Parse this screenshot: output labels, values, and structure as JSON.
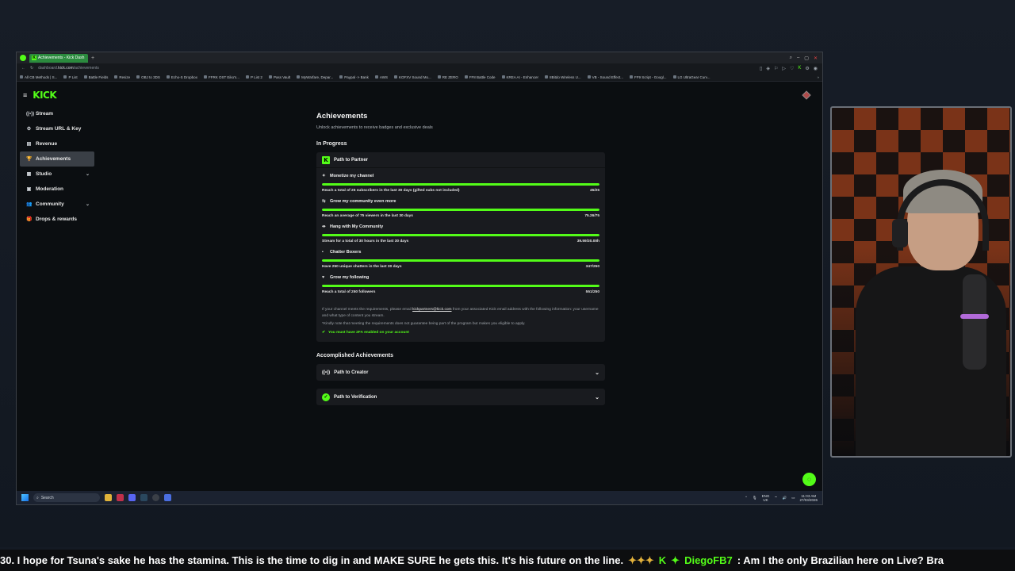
{
  "browser": {
    "tab_title": "Achievements - Kick Dash",
    "url_prefix": "dashboard.",
    "url_domain": "kick.com",
    "url_path": "/achievements",
    "bookmarks": [
      "All CB Methods | S...",
      "P List",
      "Battle Fields",
      "Resize",
      "OBJ to 3DS",
      "Echo-S Dropbox",
      "FFRK OST Eiko's...",
      "P List 2",
      "Pass Vault",
      "MyWarfare, Depar...",
      "Paypal -> Bank",
      "AWS",
      "KOFXV Sound Mo...",
      "RE ZERO",
      "FF8 Battle Code",
      "KREA AI - Enhancer",
      "8Bitdo Wireless U...",
      "VB - Sound Effect...",
      "FF9 Script - Googl...",
      "LG UltraGear Curv..."
    ]
  },
  "sidebar": {
    "logo": "KICK",
    "items": [
      {
        "label": "Stream",
        "icon": "((•))"
      },
      {
        "label": "Stream URL & Key",
        "icon": "⚙"
      },
      {
        "label": "Revenue",
        "icon": "▤"
      },
      {
        "label": "Achievements",
        "icon": "🏆"
      },
      {
        "label": "Studio",
        "icon": "▦"
      },
      {
        "label": "Moderation",
        "icon": "▣"
      },
      {
        "label": "Community",
        "icon": "👥"
      },
      {
        "label": "Drops & rewards",
        "icon": "🎁"
      }
    ]
  },
  "main": {
    "title": "Achievements",
    "subtitle": "Unlock achievements to receive badges and exclusive deals",
    "in_progress_heading": "In Progress",
    "partner": {
      "badge": "K",
      "title": "Path to Partner",
      "goals": [
        {
          "title": "Monetize my channel",
          "icon": "✦",
          "desc": "Reach a total of 25 subscribers in the last 30 days (gifted subs not included)",
          "progress": "45/25",
          "fill": 1.0
        },
        {
          "title": "Grow my community even more",
          "icon": "⇆",
          "desc": "Reach an average of 75 viewers in the last 30 days",
          "progress": "75.26/75",
          "fill": 1.0
        },
        {
          "title": "Hang with My Community",
          "icon": "⇹",
          "desc": "Stream for a total of 30 hours in the last 30 days",
          "progress": "39.59/30.00h",
          "fill": 1.0
        },
        {
          "title": "Chatter Boxers",
          "icon": "▪",
          "desc": "Have 250 unique chatters in the last 30 days",
          "progress": "347/250",
          "fill": 1.0
        },
        {
          "title": "Grow my following",
          "icon": "♥",
          "desc": "Reach a total of 250 followers",
          "progress": "551/250",
          "fill": 1.0
        }
      ],
      "note1_before": "If your channel meets the requirements, please email ",
      "note1_email": "kickpartners@kick.com",
      "note1_after": " from your associated Kick email address with the following information: your username and what type of content you stream.",
      "note2": "*Kindly note that meeting the requirements does not guarantee being part of the program but makes you eligible to apply.",
      "twofa": "You must have 2FA enabled on your account"
    },
    "accomplished_heading": "Accomplished Achievements",
    "accomplished": [
      {
        "title": "Path to Creator",
        "icon": "((•))"
      },
      {
        "title": "Path to Verification",
        "icon": "✓"
      }
    ]
  },
  "taskbar": {
    "search_placeholder": "Search",
    "lang_top": "ENG",
    "lang_bottom": "UK",
    "time": "11:03 AM",
    "date": "27/03/2026"
  },
  "ticker": {
    "message1": "30. I hope for Tsuna's sake he has the stamina. This is the time to dig in and MAKE SURE he gets this. It's his future on the line.",
    "username": "DiegoFB7",
    "message2": ": Am I the only Brazilian here on Live? Bra"
  },
  "colors": {
    "accent": "#53fc18",
    "card": "#191b1f",
    "background": "#0b0e11"
  }
}
